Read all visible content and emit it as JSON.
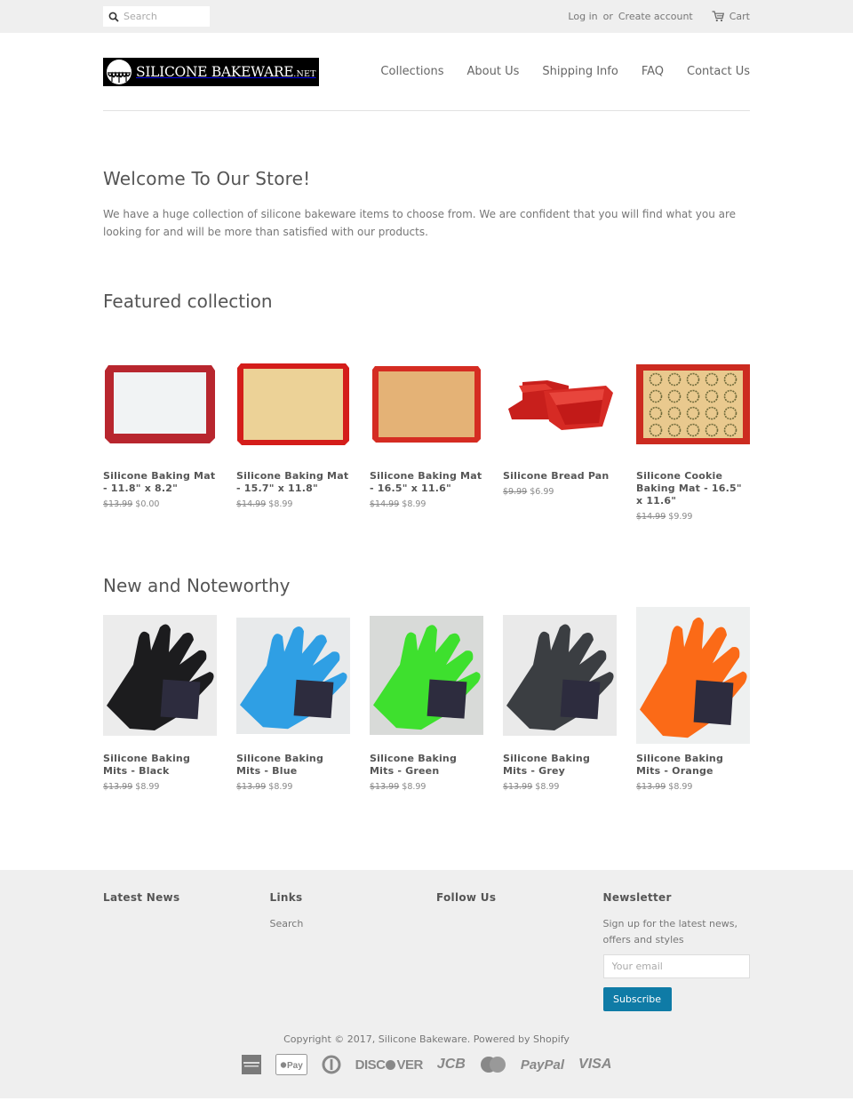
{
  "topbar": {
    "search_placeholder": "Search",
    "login": "Log in",
    "or": "or",
    "create_account": "Create account",
    "cart": "Cart"
  },
  "header": {
    "logo_main": "SILICONE BAKEWARE",
    "logo_suffix": ".NET",
    "nav": [
      "Collections",
      "About Us",
      "Shipping Info",
      "FAQ",
      "Contact Us"
    ]
  },
  "welcome": {
    "title": "Welcome To Our Store!",
    "body": "We have a huge collection of silicone bakeware items to choose from. We are confident that you will find what you are looking for and will be more than satisfied with our products."
  },
  "featured": {
    "title": "Featured collection",
    "products": [
      {
        "title": "Silicone Baking Mat - 11.8\" x 8.2\"",
        "compare_price": "$13.99",
        "price": "$0.00",
        "image": "baking-mat-white"
      },
      {
        "title": "Silicone Baking Mat - 15.7\" x 11.8\"",
        "compare_price": "$14.99",
        "price": "$8.99",
        "image": "baking-mat-yellow"
      },
      {
        "title": "Silicone Baking Mat - 16.5\" x 11.6\"",
        "compare_price": "$14.99",
        "price": "$8.99",
        "image": "baking-mat-tan"
      },
      {
        "title": "Silicone Bread Pan",
        "compare_price": "$9.99",
        "price": "$6.99",
        "image": "bread-pan"
      },
      {
        "title": "Silicone Cookie Baking Mat - 16.5\" x 11.6\"",
        "compare_price": "$14.99",
        "price": "$9.99",
        "image": "cookie-mat"
      }
    ]
  },
  "noteworthy": {
    "title": "New and Noteworthy",
    "products": [
      {
        "title": "Silicone Baking Mits - Black",
        "compare_price": "$13.99",
        "price": "$8.99",
        "color": "#1c1c1e"
      },
      {
        "title": "Silicone Baking Mits - Blue",
        "compare_price": "$13.99",
        "price": "$8.99",
        "color": "#2f9fe4"
      },
      {
        "title": "Silicone Baking Mits - Green",
        "compare_price": "$13.99",
        "price": "$8.99",
        "color": "#3ee02e"
      },
      {
        "title": "Silicone Baking Mits - Grey",
        "compare_price": "$13.99",
        "price": "$8.99",
        "color": "#3b3e42"
      },
      {
        "title": "Silicone Baking Mits - Orange",
        "compare_price": "$13.99",
        "price": "$8.99",
        "color": "#fb6a17"
      }
    ]
  },
  "footer": {
    "latest_news": "Latest News",
    "links_title": "Links",
    "links": [
      "Search"
    ],
    "follow_us": "Follow Us",
    "newsletter_title": "Newsletter",
    "newsletter_text": "Sign up for the latest news, offers and styles",
    "email_placeholder": "Your email",
    "subscribe": "Subscribe",
    "copyright": "Copyright © 2017, Silicone Bakeware. Powered by Shopify",
    "payments": [
      "American Express",
      "Apple Pay",
      "Diners Club",
      "DISCOVER",
      "JCB",
      "Master",
      "PayPal",
      "VISA"
    ]
  },
  "colors": {
    "accent": "#0f7ba6",
    "topbar_bg": "#efefef",
    "footer_bg": "#efefef",
    "text": "#555555"
  }
}
